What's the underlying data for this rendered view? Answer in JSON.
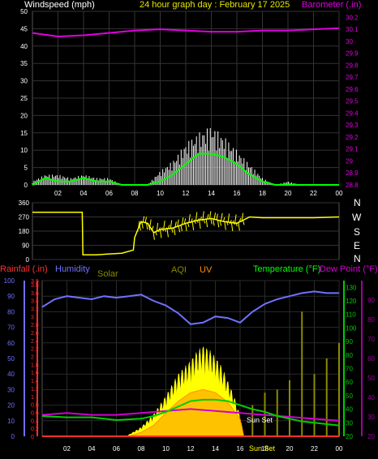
{
  "header": {
    "wind_label": "Windspeed (mph)",
    "title": "24 hour graph day : February 17 2025",
    "baro_label": "Barometer (.in)"
  },
  "bottom_header": {
    "rain_label": "Rainfall (.in)",
    "humidity_label": "Humidity",
    "solar_label": "Solar",
    "aqi_label": "AQI",
    "uv_label": "UV",
    "temp_label": "Temperature (°F)",
    "dew_label": "Dew Point (°F)"
  },
  "annotations": {
    "sunset_main": "Sun Set",
    "sunset_axis": "Sun Set"
  },
  "colors": {
    "wind": "#ffffff",
    "gust": "#00ff00",
    "baro": "#e000e0",
    "dir": "#ffff00",
    "humidity": "#7070ff",
    "temp": "#00cc00",
    "dew": "#d000d0",
    "solar": "#ffff00",
    "uv": "#ff9000",
    "aqi": "#8a8a00",
    "rain": "#ff3030"
  },
  "chart_data": [
    {
      "type": "line",
      "name": "wind-baro",
      "title": "24 hour graph day : February 17 2025",
      "xlabel": "",
      "x_ticks": [
        "02",
        "04",
        "06",
        "08",
        "10",
        "12",
        "14",
        "16",
        "18",
        "20",
        "22",
        "00"
      ],
      "y_left": {
        "label": "Windspeed (mph)",
        "ticks": [
          0,
          5,
          10,
          15,
          20,
          25,
          30,
          35,
          40,
          45,
          50
        ],
        "range": [
          0,
          50
        ]
      },
      "y_right": {
        "label": "Barometer (.in)",
        "ticks": [
          "28.8",
          "28.9",
          "29",
          "29.1",
          "29.2",
          "29.3",
          "29.4",
          "29.5",
          "29.6",
          "29.7",
          "29.8",
          "29.9",
          "30",
          "30.1",
          "30.2"
        ],
        "range": [
          28.8,
          30.25
        ]
      },
      "series": [
        {
          "name": "Barometer",
          "x": [
            0,
            2,
            4,
            6,
            8,
            10,
            12,
            14,
            16,
            18,
            20,
            22,
            24
          ],
          "values": [
            30.07,
            30.04,
            30.05,
            30.07,
            30.09,
            30.1,
            30.09,
            30.08,
            30.08,
            30.09,
            30.09,
            30.1,
            30.11
          ]
        },
        {
          "name": "Windspeed",
          "x": [
            0,
            1,
            2,
            3,
            4,
            5,
            6,
            7,
            8,
            9,
            10,
            11,
            12,
            13,
            14,
            15,
            16,
            17,
            18,
            19,
            20,
            21,
            22,
            23,
            24
          ],
          "values": [
            0,
            2,
            1,
            1,
            2,
            1,
            1,
            0,
            0,
            0,
            1,
            3,
            6,
            9,
            9,
            8,
            6,
            3,
            1,
            0,
            0,
            0,
            0,
            0,
            0
          ]
        },
        {
          "name": "Gust",
          "x": [
            0,
            1,
            2,
            3,
            4,
            5,
            6,
            7,
            8,
            9,
            10,
            11,
            12,
            13,
            14,
            15,
            16,
            17,
            18,
            19,
            20,
            21,
            22,
            23,
            24
          ],
          "values": [
            1,
            3,
            3,
            2,
            3,
            2,
            2,
            0,
            0,
            0,
            4,
            7,
            12,
            15,
            17,
            14,
            10,
            6,
            2,
            0,
            1,
            0,
            0,
            0,
            0
          ]
        }
      ]
    },
    {
      "type": "line",
      "name": "wind-direction",
      "y_ticks": [
        0,
        90,
        180,
        270,
        360
      ],
      "y_right_labels": [
        "N",
        "W",
        "S",
        "E",
        "N"
      ],
      "series": [
        {
          "name": "Direction",
          "x": [
            0,
            3.9,
            3.95,
            5,
            7,
            7.9,
            8,
            8.5,
            9,
            9.5,
            10,
            11,
            12,
            13,
            14,
            15,
            16,
            17,
            18,
            20,
            22,
            24
          ],
          "values": [
            300,
            300,
            30,
            30,
            40,
            60,
            140,
            240,
            230,
            170,
            190,
            200,
            230,
            250,
            260,
            240,
            230,
            270,
            265,
            265,
            265,
            270
          ]
        }
      ]
    },
    {
      "type": "area",
      "name": "weather-multi",
      "x_ticks": [
        "02",
        "04",
        "06",
        "08",
        "10",
        "12",
        "14",
        "16",
        "18",
        "20",
        "22",
        "00"
      ],
      "y_humidity": {
        "label": "Humidity",
        "ticks": [
          0,
          10,
          20,
          30,
          40,
          50,
          60,
          70,
          80,
          90,
          100
        ],
        "range": [
          0,
          100
        ]
      },
      "y_rain": {
        "label": "Rainfall (.in)",
        "ticks": [
          "0",
          "0.2",
          "0.4",
          "0.6",
          "0.8",
          "1",
          "1.2",
          "1.4",
          "1.6",
          "1.8",
          "2",
          "2.2",
          "2.4",
          "2.6",
          "2.8",
          "3",
          "3.2",
          "3.4",
          "3.6",
          "3.8",
          "3.9"
        ],
        "range": [
          0,
          3.9
        ]
      },
      "y_temp": {
        "label": "Temperature (°F)",
        "ticks": [
          20,
          30,
          40,
          50,
          60,
          70,
          80,
          90,
          100,
          110,
          120,
          130
        ],
        "range": [
          20,
          135
        ]
      },
      "y_dew": {
        "label": "Dew Point (°F)",
        "ticks": [
          20,
          30,
          40,
          50,
          60,
          70,
          80,
          90
        ],
        "range": [
          20,
          100
        ]
      },
      "series": [
        {
          "name": "Humidity",
          "x": [
            0,
            1,
            2,
            3,
            4,
            5,
            6,
            7,
            8,
            9,
            10,
            11,
            12,
            13,
            14,
            15,
            16,
            17,
            18,
            19,
            20,
            21,
            22,
            23,
            24
          ],
          "values": [
            83,
            88,
            90,
            89,
            88,
            90,
            89,
            90,
            91,
            87,
            84,
            79,
            72,
            73,
            77,
            76,
            73,
            80,
            85,
            88,
            90,
            92,
            93,
            92,
            92
          ]
        },
        {
          "name": "Temperature",
          "x": [
            0,
            2,
            4,
            6,
            8,
            9,
            10,
            11,
            12,
            13,
            14,
            15,
            16,
            17,
            18,
            19,
            20,
            21,
            22,
            23,
            24
          ],
          "values": [
            35,
            34,
            34,
            32,
            33,
            35,
            38,
            42,
            46,
            47,
            47,
            46,
            43,
            40,
            38,
            35,
            33,
            31,
            30,
            29,
            28
          ]
        },
        {
          "name": "Dew Point",
          "x": [
            0,
            2,
            4,
            6,
            8,
            10,
            12,
            14,
            16,
            18,
            20,
            22,
            24
          ],
          "values": [
            31,
            32,
            31,
            31,
            32,
            33,
            34,
            33,
            32,
            31,
            30,
            29,
            28
          ]
        },
        {
          "name": "Solar",
          "x": [
            6.8,
            8,
            9,
            10,
            11,
            12,
            12.5,
            13,
            13.5,
            14,
            14.5,
            15,
            15.5,
            16,
            16.3
          ],
          "values": [
            0,
            25,
            60,
            110,
            170,
            205,
            230,
            245,
            235,
            215,
            190,
            150,
            110,
            55,
            0
          ]
        },
        {
          "name": "UV",
          "x": [
            7,
            8,
            9,
            10,
            11,
            12,
            13,
            14,
            15,
            16,
            16.3
          ],
          "values": [
            0,
            5,
            14,
            30,
            45,
            56,
            60,
            56,
            44,
            22,
            0
          ]
        },
        {
          "name": "AQI",
          "x": [
            17,
            18,
            19,
            20,
            21,
            22,
            23,
            24
          ],
          "values": [
            10,
            14,
            15,
            18,
            40,
            20,
            25,
            30
          ]
        },
        {
          "name": "Rainfall",
          "x": [
            0,
            24
          ],
          "values": [
            0,
            0
          ]
        }
      ]
    }
  ]
}
